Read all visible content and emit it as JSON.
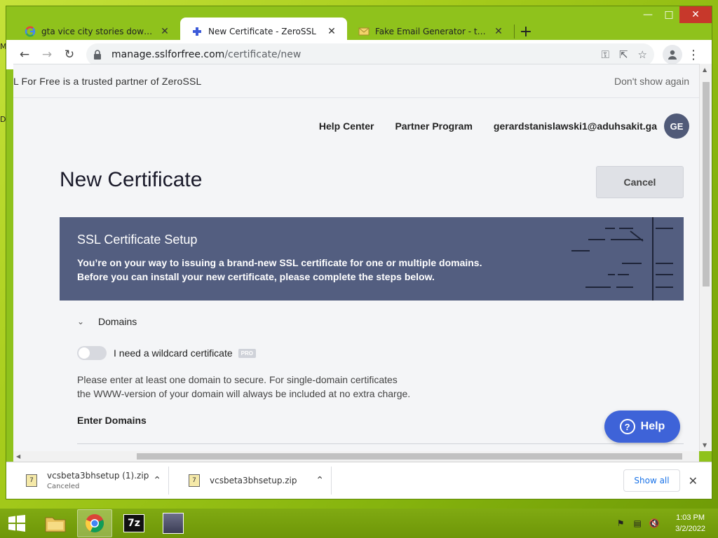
{
  "desktop": {
    "edge_letter_1": "M",
    "edge_letter_2": "D"
  },
  "browser": {
    "tabs": [
      {
        "title": "gta vice city stories download for",
        "favicon": "google-icon"
      },
      {
        "title": "New Certificate - ZeroSSL",
        "favicon": "zerossl-icon",
        "active": true
      },
      {
        "title": "Fake Email Generator - temp ma",
        "favicon": "email-icon"
      }
    ],
    "url_domain": "manage.sslforfree.com",
    "url_path": "/certificate/new"
  },
  "page": {
    "partner_text": "L For Free is a trusted partner of ZeroSSL",
    "dont_show": "Don't show again",
    "nav": {
      "help_center": "Help Center",
      "partner_program": "Partner Program",
      "email": "gerardstanislawski1@aduhsakit.ga",
      "avatar_initials": "GE"
    },
    "title": "New Certificate",
    "cancel_label": "Cancel",
    "setup": {
      "heading": "SSL Certificate Setup",
      "desc_line1": "You’re on your way to issuing a brand-new SSL certificate for one or multiple domains.",
      "desc_line2": "Before you can install your new certificate, please complete the steps below.",
      "domains_label": "Domains",
      "wildcard_label": "I need a wildcard certificate",
      "pro_badge": "PRO",
      "info_line1": "Please enter at least one domain to secure. For single-domain certificates",
      "info_line2": "the WWW-version of your domain will always be included at no extra charge.",
      "enter_domains": "Enter Domains"
    },
    "help_label": "Help"
  },
  "downloads": {
    "items": [
      {
        "name": "vcsbeta3bhsetup (1).zip",
        "status": "Canceled"
      },
      {
        "name": "vcsbeta3bhsetup.zip",
        "status": ""
      }
    ],
    "show_all": "Show all"
  },
  "taskbar": {
    "time": "1:03 PM",
    "date": "3/2/2022"
  },
  "colors": {
    "header_bg": "#535e80",
    "help_btn": "#3e63d8",
    "avatar_bg": "#505a78"
  }
}
